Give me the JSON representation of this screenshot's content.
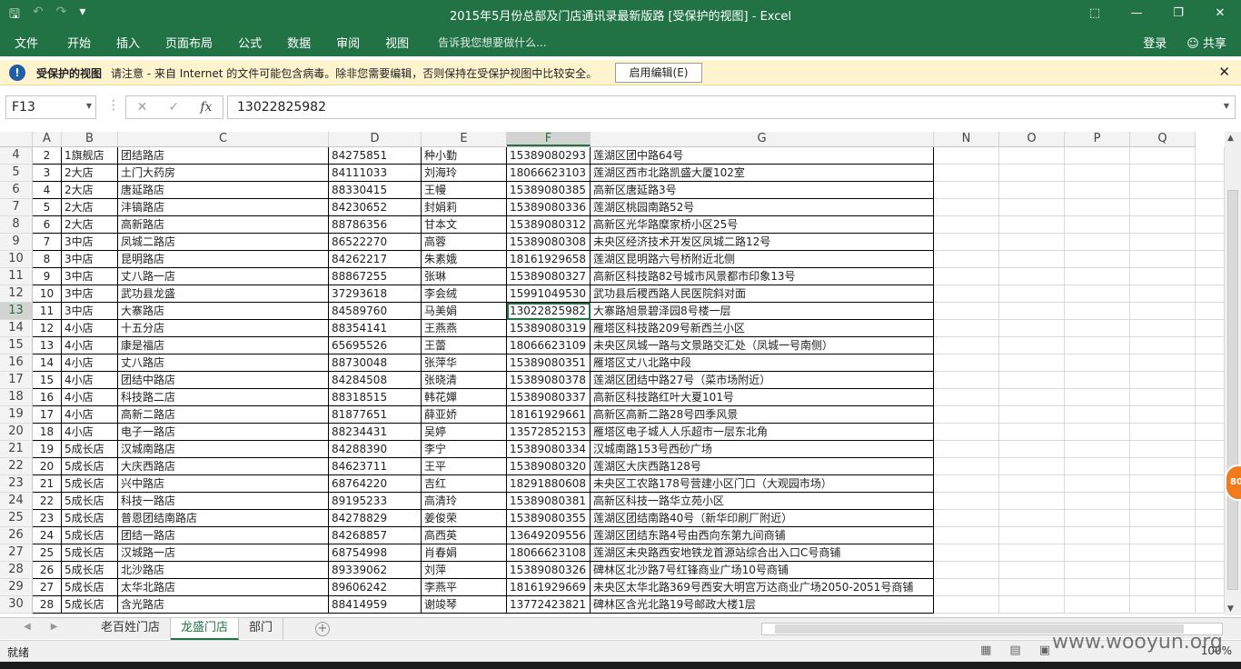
{
  "window": {
    "title": "2015年5月份总部及门店通讯录最新版路  [受保护的视图] - Excel",
    "qat": [
      "save-icon",
      "undo-icon",
      "redo-icon",
      "customize-icon"
    ]
  },
  "ribbon": {
    "tabs": [
      "文件",
      "开始",
      "插入",
      "页面布局",
      "公式",
      "数据",
      "审阅",
      "视图"
    ],
    "tell_me": "告诉我您想要做什么...",
    "login": "登录",
    "share": "共享"
  },
  "protected_bar": {
    "label": "受保护的视图",
    "message": "请注意 - 来自 Internet 的文件可能包含病毒。除非您需要编辑，否则保持在受保护视图中比较安全。",
    "enable_button": "启用编辑(E)"
  },
  "formula_bar": {
    "name_box": "F13",
    "formula": "13022825982"
  },
  "columns": [
    "A",
    "B",
    "C",
    "D",
    "E",
    "F",
    "G",
    "N",
    "O",
    "P",
    "Q"
  ],
  "rows": [
    {
      "r": "4",
      "a": "2",
      "b": "1旗舰店",
      "c": "团结路店",
      "d": "84275851",
      "e": "种小勤",
      "f": "15389080293",
      "g": "莲湖区团中路64号"
    },
    {
      "r": "5",
      "a": "3",
      "b": "2大店",
      "c": "土门大药房",
      "d": "84111033",
      "e": "刘海玲",
      "f": "18066623103",
      "g": "莲湖区西市北路凯盛大厦102室"
    },
    {
      "r": "6",
      "a": "4",
      "b": "2大店",
      "c": "唐延路店",
      "d": "88330415",
      "e": "王幔",
      "f": "15389080385",
      "g": "高新区唐延路3号"
    },
    {
      "r": "7",
      "a": "5",
      "b": "2大店",
      "c": "沣镐路店",
      "d": "84230652",
      "e": "封娟莉",
      "f": "15389080336",
      "g": "莲湖区桃园南路52号"
    },
    {
      "r": "8",
      "a": "6",
      "b": "2大店",
      "c": "高新路店",
      "d": "88786356",
      "e": "甘本文",
      "f": "15389080312",
      "g": "高新区光华路糜家桥小区25号"
    },
    {
      "r": "9",
      "a": "7",
      "b": "3中店",
      "c": "凤城二路店",
      "d": "86522270",
      "e": "高蓉",
      "f": "15389080308",
      "g": "未央区经济技术开发区凤城二路12号"
    },
    {
      "r": "10",
      "a": "8",
      "b": "3中店",
      "c": "昆明路店",
      "d": "84262217",
      "e": "朱素娥",
      "f": "18161929658",
      "g": "莲湖区昆明路六号桥附近北侧"
    },
    {
      "r": "11",
      "a": "9",
      "b": "3中店",
      "c": "丈八路一店",
      "d": "88867255",
      "e": "张琳",
      "f": "15389080327",
      "g": "高新区科技路82号城市风景都市印象13号"
    },
    {
      "r": "12",
      "a": "10",
      "b": "3中店",
      "c": "武功县龙盛",
      "d": "37293618",
      "e": "李会绒",
      "f": "15991049530",
      "g": "武功县后稷西路人民医院斜对面"
    },
    {
      "r": "13",
      "a": "11",
      "b": "3中店",
      "c": "大寨路店",
      "d": "84589760",
      "e": "马美娟",
      "f": "13022825982",
      "g": "大寨路旭景碧泽园8号楼一层"
    },
    {
      "r": "14",
      "a": "12",
      "b": "4小店",
      "c": "十五分店",
      "d": "88354141",
      "e": "王燕燕",
      "f": "15389080319",
      "g": "雁塔区科技路209号新西兰小区"
    },
    {
      "r": "15",
      "a": "13",
      "b": "4小店",
      "c": "康是福店",
      "d": "65695526",
      "e": "王蕾",
      "f": "18066623109",
      "g": "未央区凤城一路与文景路交汇处（凤城一号南侧）"
    },
    {
      "r": "16",
      "a": "14",
      "b": "4小店",
      "c": "丈八路店",
      "d": "88730048",
      "e": "张萍华",
      "f": "15389080351",
      "g": "雁塔区丈八北路中段"
    },
    {
      "r": "17",
      "a": "15",
      "b": "4小店",
      "c": "团结中路店",
      "d": "84284508",
      "e": "张晓清",
      "f": "15389080378",
      "g": "莲湖区团结中路27号（菜市场附近）"
    },
    {
      "r": "18",
      "a": "16",
      "b": "4小店",
      "c": "科技路二店",
      "d": "88318515",
      "e": "韩花嬋",
      "f": "15389080337",
      "g": "高新区科技路红叶大夏101号"
    },
    {
      "r": "19",
      "a": "17",
      "b": "4小店",
      "c": "高新二路店",
      "d": "81877651",
      "e": "薛亚娇",
      "f": "18161929661",
      "g": "高新区高新二路28号四季风景"
    },
    {
      "r": "20",
      "a": "18",
      "b": "4小店",
      "c": "电子一路店",
      "d": "88234431",
      "e": "吴婷",
      "f": "13572852153",
      "g": "雁塔区电子城人人乐超市一层东北角"
    },
    {
      "r": "21",
      "a": "19",
      "b": "5成长店",
      "c": "汉城南路店",
      "d": "84288390",
      "e": "李宁",
      "f": "15389080334",
      "g": "汉城南路153号西砂广场"
    },
    {
      "r": "22",
      "a": "20",
      "b": "5成长店",
      "c": "大庆西路店",
      "d": "84623711",
      "e": "王平",
      "f": "15389080320",
      "g": "莲湖区大庆西路128号"
    },
    {
      "r": "23",
      "a": "21",
      "b": "5成长店",
      "c": "兴中路店",
      "d": "68764220",
      "e": "吉红",
      "f": "18291880608",
      "g": "未央区工农路178号营建小区门口（大观园市场）"
    },
    {
      "r": "24",
      "a": "22",
      "b": "5成长店",
      "c": "科技一路店",
      "d": "89195233",
      "e": "高清玲",
      "f": "15389080381",
      "g": "高新区科技一路华立苑小区"
    },
    {
      "r": "25",
      "a": "23",
      "b": "5成长店",
      "c": "普恩团结南路店",
      "d": "84278829",
      "e": "姜俊荣",
      "f": "15389080355",
      "g": "莲湖区团结南路40号（新华印刷厂附近）"
    },
    {
      "r": "26",
      "a": "24",
      "b": "5成长店",
      "c": "团结一路店",
      "d": "84268857",
      "e": "高西英",
      "f": "13649209556",
      "g": "莲湖区团结东路4号由西向东第九间商铺"
    },
    {
      "r": "27",
      "a": "25",
      "b": "5成长店",
      "c": "汉城路一店",
      "d": "68754998",
      "e": "肖春娟",
      "f": "18066623108",
      "g": "莲湖区未央路西安地铁龙首源站综合出入口C号商铺"
    },
    {
      "r": "28",
      "a": "26",
      "b": "5成长店",
      "c": "北沙路店",
      "d": "89339062",
      "e": "刘萍",
      "f": "15389080326",
      "g": "碑林区北沙路7号红锋商业广场10号商铺"
    },
    {
      "r": "29",
      "a": "27",
      "b": "5成长店",
      "c": "太华北路店",
      "d": "89606242",
      "e": "李燕平",
      "f": "18161929669",
      "g": "未央区太华北路369号西安大明宫万达商业广场2050-2051号商铺"
    },
    {
      "r": "30",
      "a": "28",
      "b": "5成长店",
      "c": "含光路店",
      "d": "88414959",
      "e": "谢竣琴",
      "f": "13772423821",
      "g": "碑林区含光北路19号邮政大楼1层"
    }
  ],
  "active_row": "13",
  "sheets": [
    "老百姓门店",
    "龙盛门店",
    "部门"
  ],
  "active_sheet": "龙盛门店",
  "status": {
    "ready": "就绪",
    "zoom": "100%"
  },
  "overlay": {
    "badge": "80",
    "watermark": "www.wooyun.org"
  }
}
